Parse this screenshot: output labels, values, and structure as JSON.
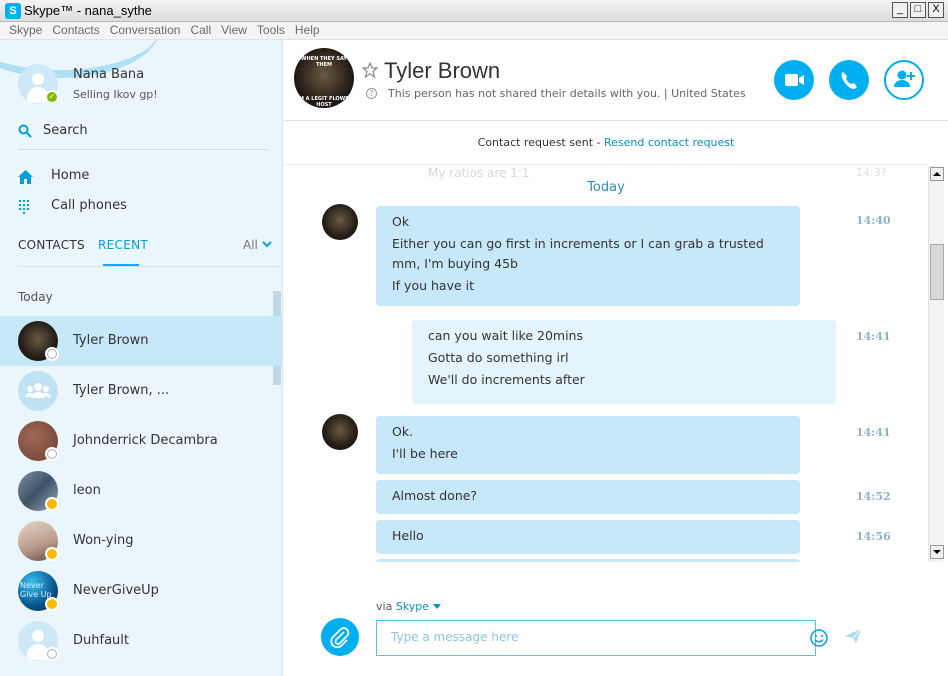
{
  "window": {
    "title": "Skype™ - nana_sythe",
    "logo_letter": "S",
    "controls": [
      "_",
      "□",
      "X"
    ]
  },
  "menu": [
    "Skype",
    "Contacts",
    "Conversation",
    "Call",
    "View",
    "Tools",
    "Help"
  ],
  "profile": {
    "name": "Nana Bana",
    "mood": "Selling Ikov gp!",
    "status": "online"
  },
  "sidebar": {
    "search_label": "Search",
    "nav": [
      {
        "label": "Home",
        "icon": "home-icon"
      },
      {
        "label": "Call phones",
        "icon": "dialpad-icon"
      }
    ],
    "tabs": {
      "contacts": "CONTACTS",
      "recent": "RECENT",
      "filter": "All"
    },
    "section": "Today",
    "contacts": [
      {
        "name": "Tyler Brown",
        "status": "unknown",
        "avatar": "dark",
        "selected": true
      },
      {
        "name": "Tyler Brown, ...",
        "status": "",
        "avatar": "group"
      },
      {
        "name": "Johnderrick Decambra",
        "status": "unknown",
        "avatar": "brown"
      },
      {
        "name": "leon",
        "status": "away",
        "avatar": "photo1"
      },
      {
        "name": "Won-ying",
        "status": "away",
        "avatar": "photo2"
      },
      {
        "name": "NeverGiveUp",
        "status": "away",
        "avatar": "photo3",
        "avatar_text": "Never Give Up"
      },
      {
        "name": "Duhfault",
        "status": "unknown",
        "avatar": "default"
      }
    ]
  },
  "header": {
    "name": "Tyler Brown",
    "details": "This person has not shared their details with you.  |  United States",
    "avatar_text_top": "WHEN THEY SAY THEM",
    "avatar_text_bottom": "I'M A LEGIT FLOWER HOST",
    "accent": "#00aff0"
  },
  "request": {
    "text": "Contact request sent - ",
    "link": "Resend contact request"
  },
  "chat": {
    "ghost_text": "My ratios are 1:1",
    "day": "Today",
    "messages": [
      {
        "dir": "in",
        "lines": [
          "Ok",
          "Either you can go first in increments or I can grab a trusted",
          "mm, I'm buying 45b",
          "If you have it"
        ],
        "time": "14:40"
      },
      {
        "dir": "out",
        "lines": [
          "can you wait like 20mins",
          "Gotta do something irl",
          "We'll do increments after"
        ],
        "time": "14:41"
      },
      {
        "dir": "in",
        "lines": [
          "Ok.",
          "I'll be here"
        ],
        "time": "14:41"
      },
      {
        "dir": "in",
        "lines": [
          "Almost done?"
        ],
        "time": "14:52"
      },
      {
        "dir": "in",
        "lines": [
          "Hello"
        ],
        "time": "14:56"
      }
    ]
  },
  "composer": {
    "via_label": "via",
    "via_service": "Skype",
    "placeholder": "Type a message here"
  }
}
